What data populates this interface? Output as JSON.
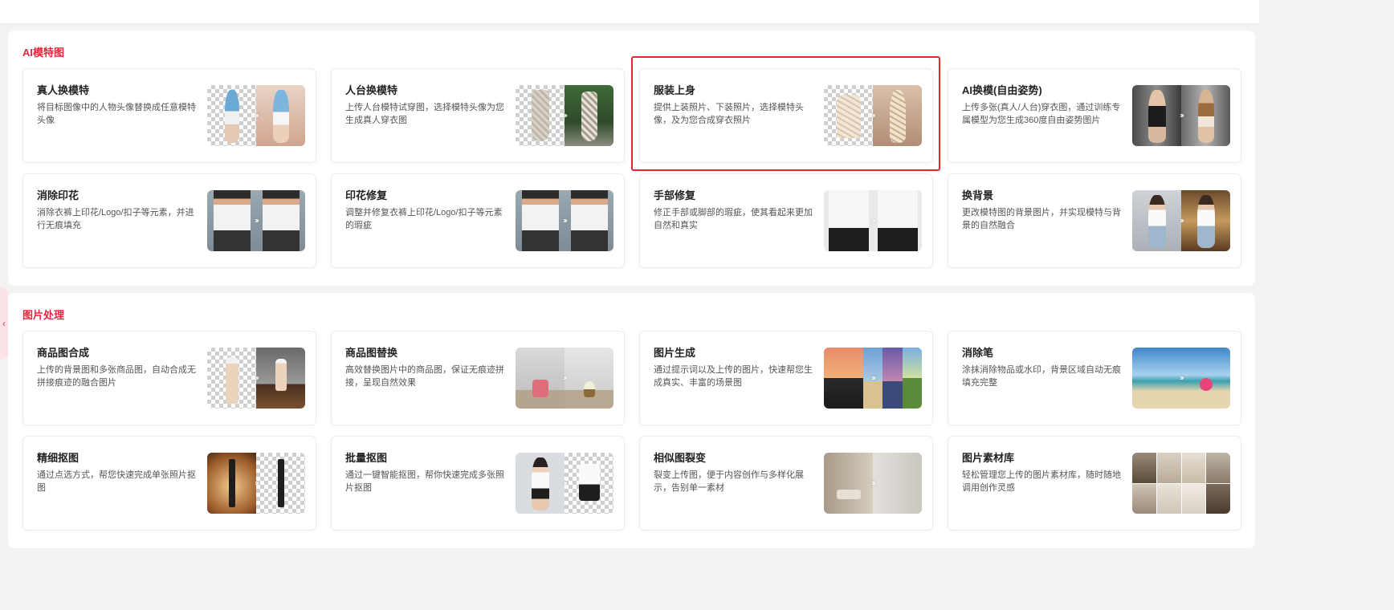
{
  "sections": [
    {
      "title": "AI模特图",
      "cards": [
        {
          "title": "真人换模特",
          "desc": "将目标图像中的人物头像替换成任意模特头像"
        },
        {
          "title": "人台换模特",
          "desc": "上传人台模特试穿图，选择模特头像为您生成真人穿衣图"
        },
        {
          "title": "服装上身",
          "desc": "提供上装照片、下装照片，选择模特头像，及为您合成穿衣照片"
        },
        {
          "title": "AI换模(自由姿势)",
          "desc": "上传多张(真人/人台)穿衣图，通过训练专属模型为您生成360度自由姿势图片"
        },
        {
          "title": "消除印花",
          "desc": "消除衣裤上印花/Logo/扣子等元素，并进行无痕填充"
        },
        {
          "title": "印花修复",
          "desc": "调整并修复衣裤上印花/Logo/扣子等元素的瑕疵"
        },
        {
          "title": "手部修复",
          "desc": "修正手部或脚部的瑕疵，使其看起来更加自然和真实"
        },
        {
          "title": "换背景",
          "desc": "更改模特图的背景图片，并实现模特与背景的自然融合"
        }
      ]
    },
    {
      "title": "图片处理",
      "cards": [
        {
          "title": "商品图合成",
          "desc": "上传的背景图和多张商品图，自动合成无拼接痕迹的融合图片"
        },
        {
          "title": "商品图替换",
          "desc": "高效替换图片中的商品图，保证无痕迹拼接，呈现自然效果"
        },
        {
          "title": "图片生成",
          "desc": "通过提示词以及上传的图片，快速帮您生成真实、丰富的场景图"
        },
        {
          "title": "消除笔",
          "desc": "涂抹消除物品或水印，背景区域自动无痕填充完整"
        },
        {
          "title": "精细抠图",
          "desc": "通过点选方式，帮您快速完成单张照片抠图"
        },
        {
          "title": "批量抠图",
          "desc": "通过一键智能抠图，帮你快速完成多张照片抠图"
        },
        {
          "title": "相似图裂变",
          "desc": "裂变上传图，便于内容创作与多样化展示，告别单一素材"
        },
        {
          "title": "图片素材库",
          "desc": "轻松管理您上传的图片素材库，随时随地调用创作灵感"
        }
      ]
    }
  ],
  "colors": {
    "accent": "#e8253c",
    "highlight": "#e3262f"
  },
  "icons": {
    "collapse": "chevron-left-icon",
    "transform": "double-arrow-right-icon"
  }
}
